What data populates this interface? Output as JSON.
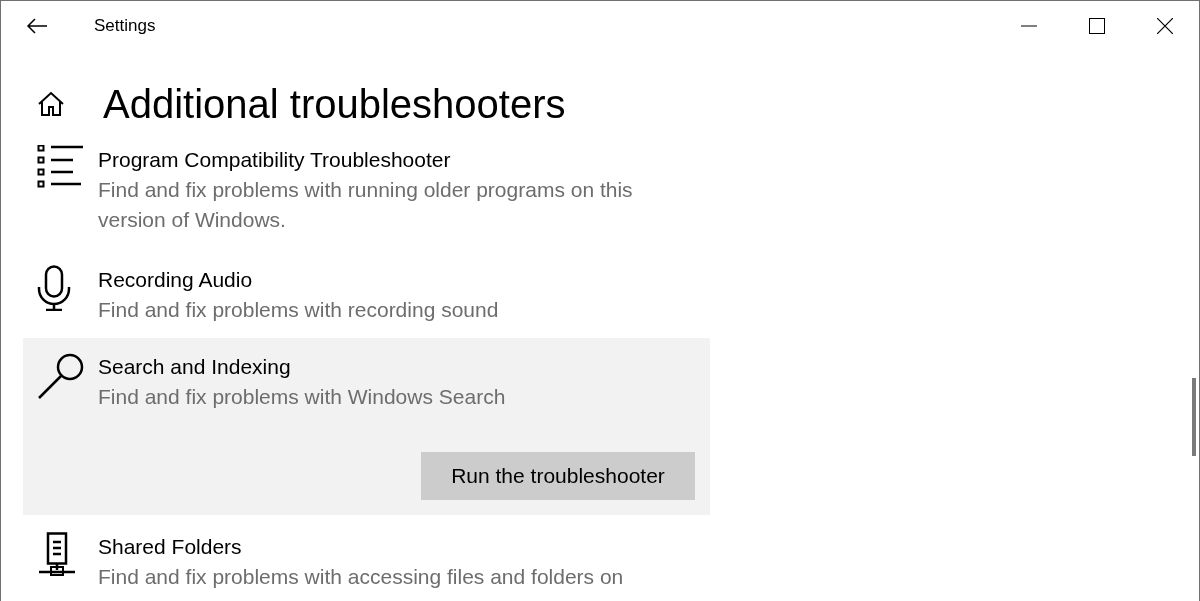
{
  "window": {
    "title": "Settings"
  },
  "page": {
    "heading": "Additional troubleshooters"
  },
  "items": [
    {
      "kind": "list",
      "title": "Program Compatibility Troubleshooter",
      "description": "Find and fix problems with running older programs on this version of Windows.",
      "selected": false
    },
    {
      "kind": "microphone",
      "title": "Recording Audio",
      "description": "Find and fix problems with recording sound",
      "selected": false
    },
    {
      "kind": "search",
      "title": "Search and Indexing",
      "description": "Find and fix problems with Windows Search",
      "selected": true,
      "button": "Run the troubleshooter"
    },
    {
      "kind": "server",
      "title": "Shared Folders",
      "description": "Find and fix problems with accessing files and folders on",
      "selected": false
    }
  ]
}
